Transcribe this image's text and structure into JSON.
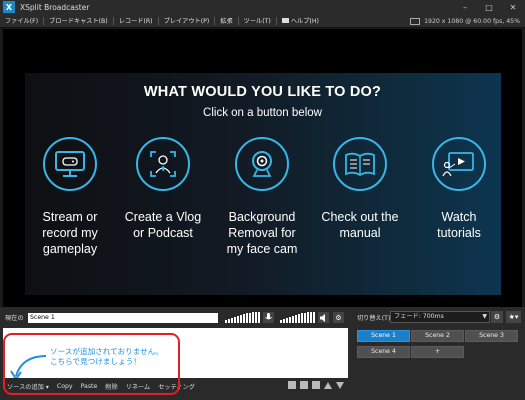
{
  "window": {
    "title": "XSplit Broadcaster",
    "logo_letter": "X"
  },
  "menu": {
    "items": [
      "ファイル(F)",
      "ブロードキャスト(B)",
      "レコード(R)",
      "プレイアウト(P)",
      "拡張",
      "ツール(T)"
    ],
    "help": "ヘルプ(H)",
    "resolution": "1920 x 1080 @ 60.00 fps, 45%"
  },
  "welcome": {
    "heading": "WHAT WOULD YOU LIKE TO DO?",
    "subheading": "Click on a button below",
    "options": [
      {
        "icon": "gamepad-monitor-icon",
        "label_lines": [
          "Stream or",
          "record my",
          "gameplay"
        ]
      },
      {
        "icon": "vlog-podcast-icon",
        "label_lines": [
          "Create a Vlog",
          "or Podcast"
        ]
      },
      {
        "icon": "webcam-icon",
        "label_lines": [
          "Background",
          "Removal for",
          "my face cam"
        ]
      },
      {
        "icon": "manual-book-icon",
        "label_lines": [
          "Check out the",
          "manual"
        ]
      },
      {
        "icon": "video-tutorial-icon",
        "label_lines": [
          "Watch",
          "tutorials"
        ]
      }
    ]
  },
  "scene_bar": {
    "current_label": "現在の",
    "scene_name": "Scene 1"
  },
  "sources": {
    "empty_message_line1": "ソースが追加されておりません。",
    "empty_message_line2": "こちらで見つけましょう！",
    "toolbar": [
      "ソースの追加 ▾",
      "Copy",
      "Paste",
      "削除",
      "リネーム",
      "セッティング"
    ]
  },
  "transitions": {
    "label": "切り替え(T)",
    "value": "フェード: 700ms"
  },
  "scenes": [
    "Scene 1",
    "Scene 2",
    "Scene 3",
    "Scene 4",
    "+"
  ],
  "colors": {
    "accent": "#37b6e8",
    "active_scene": "#1e7fc9",
    "highlight": "#e01f26"
  }
}
